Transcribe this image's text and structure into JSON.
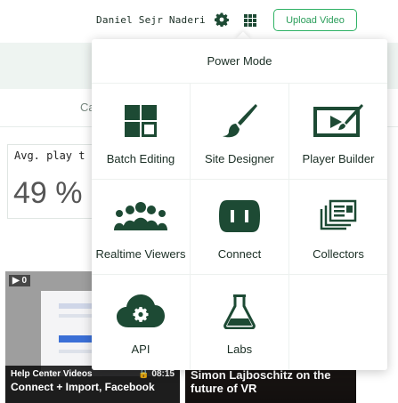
{
  "header": {
    "user_name": "Daniel Sejr Naderi",
    "upload_label": "Upload Video",
    "accent": "#2fb265"
  },
  "background": {
    "tab_partial": "Ca",
    "stat_label": "Avg. play t",
    "stat_value": "49 %",
    "videos": [
      {
        "play_count": "▶ 0",
        "category": "Help Center Videos",
        "duration": "🔒 08:15",
        "title": "Connect + Import, Facebook"
      },
      {
        "title": "Simon Lajboschitz on the future of VR"
      }
    ]
  },
  "power_mode": {
    "title": "Power Mode",
    "icon_color": "#1d4a34",
    "items": [
      {
        "label": "Batch Editing",
        "icon": "batch-editing-icon"
      },
      {
        "label": "Site Designer",
        "icon": "paintbrush-icon"
      },
      {
        "label": "Player Builder",
        "icon": "player-builder-icon"
      },
      {
        "label": "Realtime Viewers",
        "icon": "people-icon"
      },
      {
        "label": "Connect",
        "icon": "plug-icon"
      },
      {
        "label": "Collectors",
        "icon": "collectors-icon"
      },
      {
        "label": "API",
        "icon": "cloud-gear-icon"
      },
      {
        "label": "Labs",
        "icon": "flask-icon"
      }
    ]
  }
}
